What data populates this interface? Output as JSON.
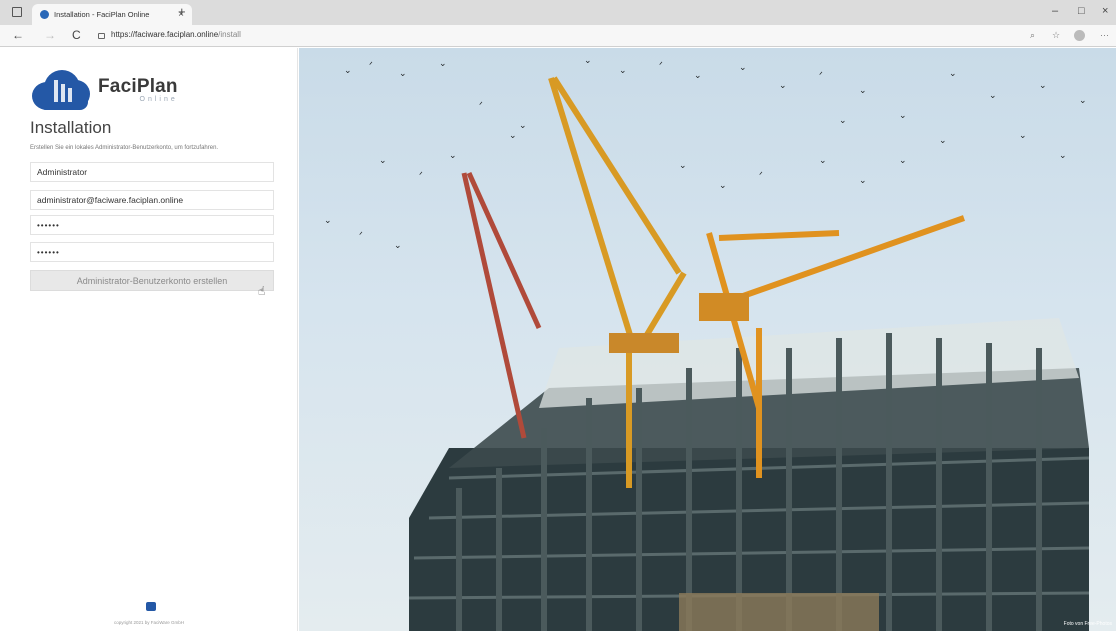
{
  "browser": {
    "tab_title": "Installation - FaciPlan Online",
    "tab_close": "×",
    "new_tab": "+",
    "url_host": "https://faciware.faciplan.online",
    "url_path": "/install",
    "back": "←",
    "forward": "→",
    "reload": "C",
    "minimize": "–",
    "maximize": "□",
    "close": "×",
    "more": "···"
  },
  "brand": {
    "name": "FaciPlan",
    "sub": "Online",
    "color": "#2458a6"
  },
  "form": {
    "title": "Installation",
    "intro": "Erstellen Sie ein lokales Administrator-Benutzerkonto, um fortzufahren.",
    "name_value": "Administrator",
    "email_value": "administrator@faciware.faciplan.online",
    "password_value": "••••••",
    "password_confirm_value": "••••••",
    "submit_label": "Administrator-Benutzerkonto erstellen"
  },
  "footer": {
    "copyright": "copyright 2021 by FaciWare GmbH"
  },
  "hero": {
    "credit": "Foto von Free-Photos"
  }
}
